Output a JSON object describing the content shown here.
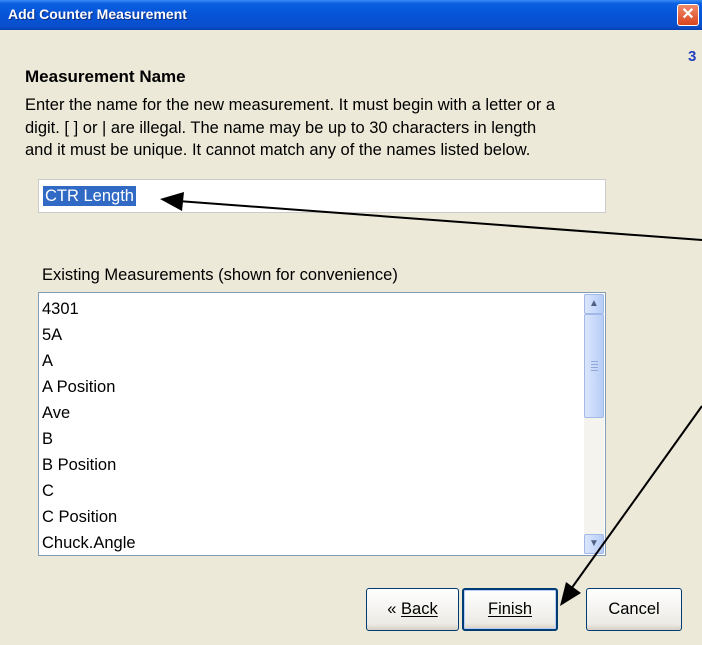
{
  "window": {
    "title": "Add Counter Measurement",
    "close_glyph": "✕",
    "step": "3"
  },
  "section": {
    "heading": "Measurement Name",
    "lines": [
      "Enter the name for the new measurement.  It must begin with a letter or a",
      "digit.  [  ]  or  |  are illegal.  The name may be up to 30 characters in length",
      "and it must be unique.  It cannot match any of the names listed below."
    ]
  },
  "name_field": {
    "value": "CTR Length"
  },
  "existing": {
    "label": "Existing Measurements (shown for convenience)",
    "items": [
      "4301",
      "5A",
      "A",
      "A Position",
      "Ave",
      "B",
      "B Position",
      "C",
      "C Position",
      "Chuck.Angle"
    ]
  },
  "buttons": {
    "back_prefix": "«",
    "back": "Back",
    "finish": "Finish",
    "cancel": "Cancel"
  },
  "colors": {
    "titlebar": "#0554d8",
    "dialog_bg": "#ece9d8",
    "selection": "#316ac5",
    "accent_step": "#1f3fbf"
  },
  "icons": {
    "close": "close-icon",
    "scroll_up": "chevron-up-icon",
    "scroll_down": "chevron-down-icon"
  }
}
